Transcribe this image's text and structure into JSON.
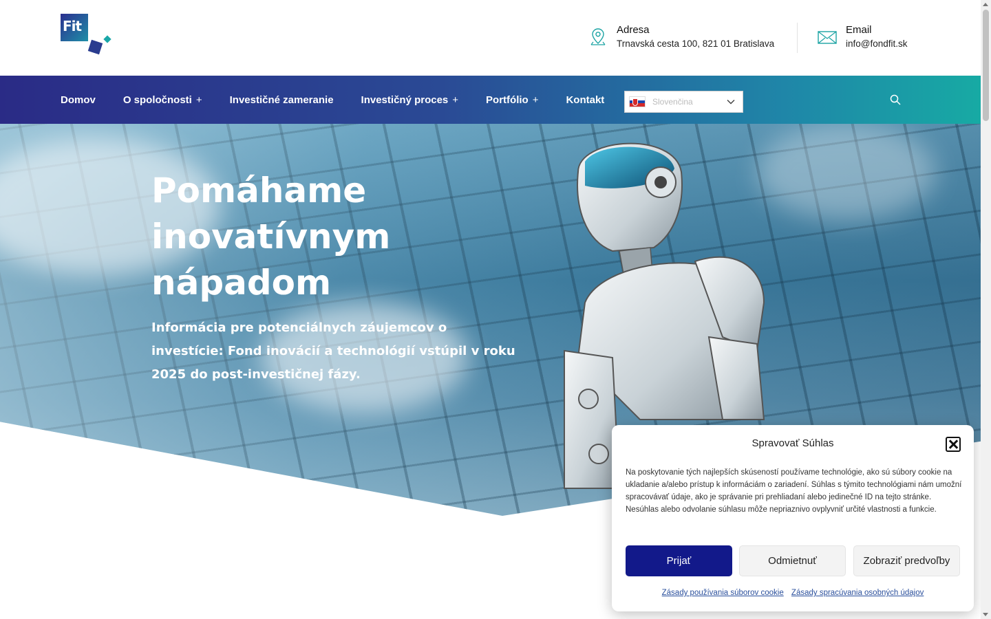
{
  "header": {
    "logo_text": "Fit",
    "address": {
      "title": "Adresa",
      "value": "Trnavská cesta 100, 821 01 Bratislava",
      "icon": "map-pin-icon"
    },
    "email": {
      "title": "Email",
      "value": "info@fondfit.sk",
      "icon": "envelope-icon"
    }
  },
  "nav": {
    "items": [
      {
        "label": "Domov",
        "has_submenu": false
      },
      {
        "label": "O spoločnosti",
        "has_submenu": true
      },
      {
        "label": "Investičné zameranie",
        "has_submenu": false
      },
      {
        "label": "Investičný proces",
        "has_submenu": true
      },
      {
        "label": "Portfólio",
        "has_submenu": true
      },
      {
        "label": "Kontakt",
        "has_submenu": false
      }
    ],
    "submenu_marker": "+",
    "language": {
      "selected": "Slovenčina",
      "flag": "slovakia-flag"
    },
    "search_icon": "search-icon"
  },
  "hero": {
    "title": "Pomáhame inovatívnym nápadom",
    "subtitle": "Informácia pre potenciálnych záujemcov o investície: Fond inovácií a technológií vstúpil v roku 2025 do post-investičnej fázy."
  },
  "cookie": {
    "title": "Spravovať Súhlas",
    "text": "Na poskytovanie tých najlepších skúseností používame technológie, ako sú súbory cookie na ukladanie a/alebo prístup k informáciám o zariadení. Súhlas s týmito technológiami nám umožní spracovávať údaje, ako je správanie pri prehliadaní alebo jedinečné ID na tejto stránke. Nesúhlas alebo odvolanie súhlasu môže nepriaznivo ovplyvniť určité vlastnosti a funkcie.",
    "accept_label": "Prijať",
    "deny_label": "Odmietnuť",
    "prefs_label": "Zobraziť predvoľby",
    "link_cookie_policy": "Zásady používania súborov cookie",
    "link_privacy": "Zásady spracúvania osobných údajov"
  },
  "colors": {
    "nav_gradient_start": "#2a2b86",
    "nav_gradient_end": "#17aaa4",
    "accept_button": "#12198a",
    "link": "#2a4f9c"
  }
}
